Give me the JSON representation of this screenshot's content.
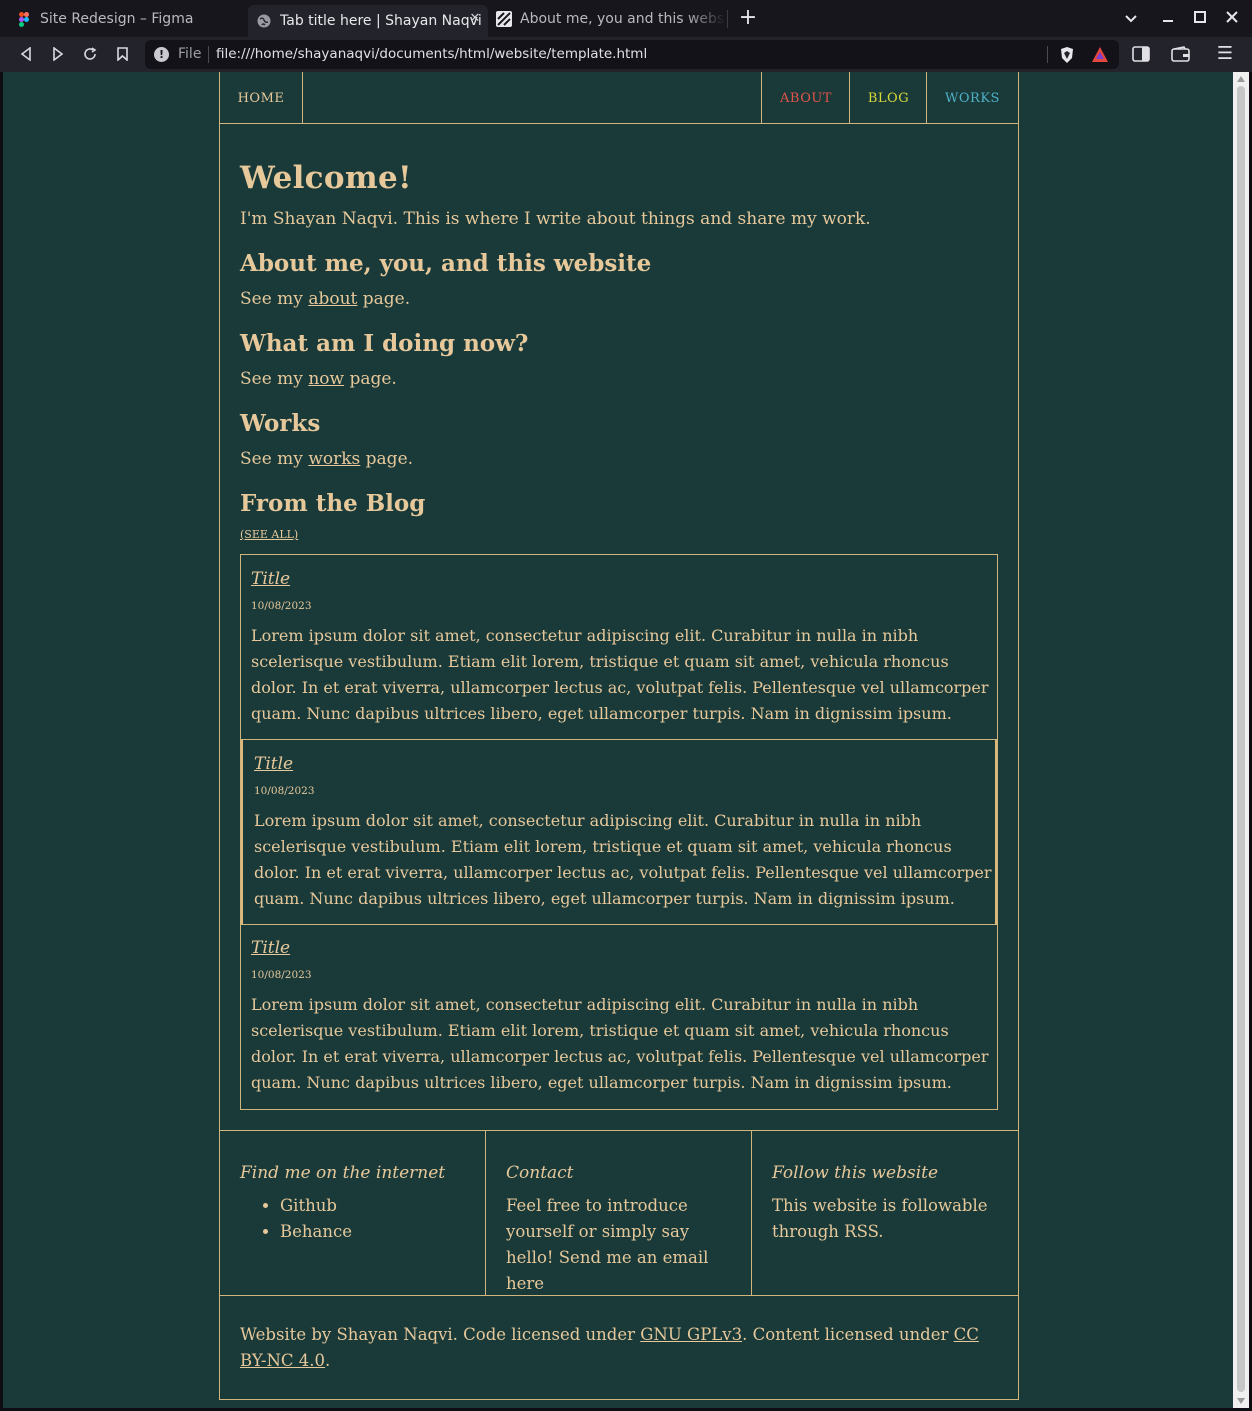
{
  "browser": {
    "tabs": [
      {
        "title": "Site Redesign – Figma",
        "active": false,
        "icon": "figma-icon"
      },
      {
        "title": "Tab title here | Shayan Naqvi",
        "active": true,
        "icon": "globe-icon"
      },
      {
        "title": "About me, you and this website",
        "active": false,
        "icon": "site-logo-icon"
      }
    ],
    "url_scheme": "File",
    "url": "file:///home/shayanaqvi/documents/html/website/template.html"
  },
  "site": {
    "nav": {
      "home": "HOME",
      "about": "ABOUT",
      "blog": "BLOG",
      "works": "WORKS"
    },
    "welcome": {
      "title": "Welcome!",
      "intro": "I'm Shayan Naqvi. This is where I write about things and share my work."
    },
    "sections": [
      {
        "heading": "About me, you, and this website",
        "pre": "See my ",
        "link": "about",
        "post": " page."
      },
      {
        "heading": "What am I doing now?",
        "pre": "See my ",
        "link": "now",
        "post": " page."
      },
      {
        "heading": "Works",
        "pre": "See my ",
        "link": "works",
        "post": " page."
      }
    ],
    "blog": {
      "heading": "From the Blog",
      "see_all": "(SEE ALL)",
      "posts": [
        {
          "title": "Title",
          "date": "10/08/2023",
          "body": "Lorem ipsum dolor sit amet, consectetur adipiscing elit. Curabitur in nulla in nibh scelerisque vestibulum. Etiam elit lorem, tristique et quam sit amet, vehicula rhoncus dolor. In et erat viverra, ullamcorper lectus ac, volutpat felis. Pellentesque vel ullamcorper quam. Nunc dapibus ultrices libero, eget ullamcorper turpis. Nam in dignissim ipsum."
        },
        {
          "title": "Title",
          "date": "10/08/2023",
          "body": "Lorem ipsum dolor sit amet, consectetur adipiscing elit. Curabitur in nulla in nibh scelerisque vestibulum. Etiam elit lorem, tristique et quam sit amet, vehicula rhoncus dolor. In et erat viverra, ullamcorper lectus ac, volutpat felis. Pellentesque vel ullamcorper quam. Nunc dapibus ultrices libero, eget ullamcorper turpis. Nam in dignissim ipsum."
        },
        {
          "title": "Title",
          "date": "10/08/2023",
          "body": "Lorem ipsum dolor sit amet, consectetur adipiscing elit. Curabitur in nulla in nibh scelerisque vestibulum. Etiam elit lorem, tristique et quam sit amet, vehicula rhoncus dolor. In et erat viverra, ullamcorper lectus ac, volutpat felis. Pellentesque vel ullamcorper quam. Nunc dapibus ultrices libero, eget ullamcorper turpis. Nam in dignissim ipsum."
        }
      ]
    },
    "footer": {
      "find_me": {
        "heading": "Find me on the internet",
        "links": [
          "Github",
          "Behance"
        ]
      },
      "contact": {
        "heading": "Contact",
        "text": "Feel free to introduce yourself or simply say hello! Send me an email here"
      },
      "follow": {
        "heading": "Follow this website",
        "text": "This website is followable through RSS."
      },
      "legal": {
        "pre": "Website by Shayan Naqvi. Code licensed under ",
        "code_license": "GNU GPLv3",
        "mid": ". Content licensed under ",
        "content_license": "CC BY-NC 4.0",
        "post": "."
      }
    }
  },
  "colors": {
    "page_bg": "#1a3a3a",
    "text": "#e6c89a",
    "border": "#d1b57e",
    "about": "#e2544b",
    "blog": "#d7d93a",
    "works": "#4fb0c6"
  }
}
